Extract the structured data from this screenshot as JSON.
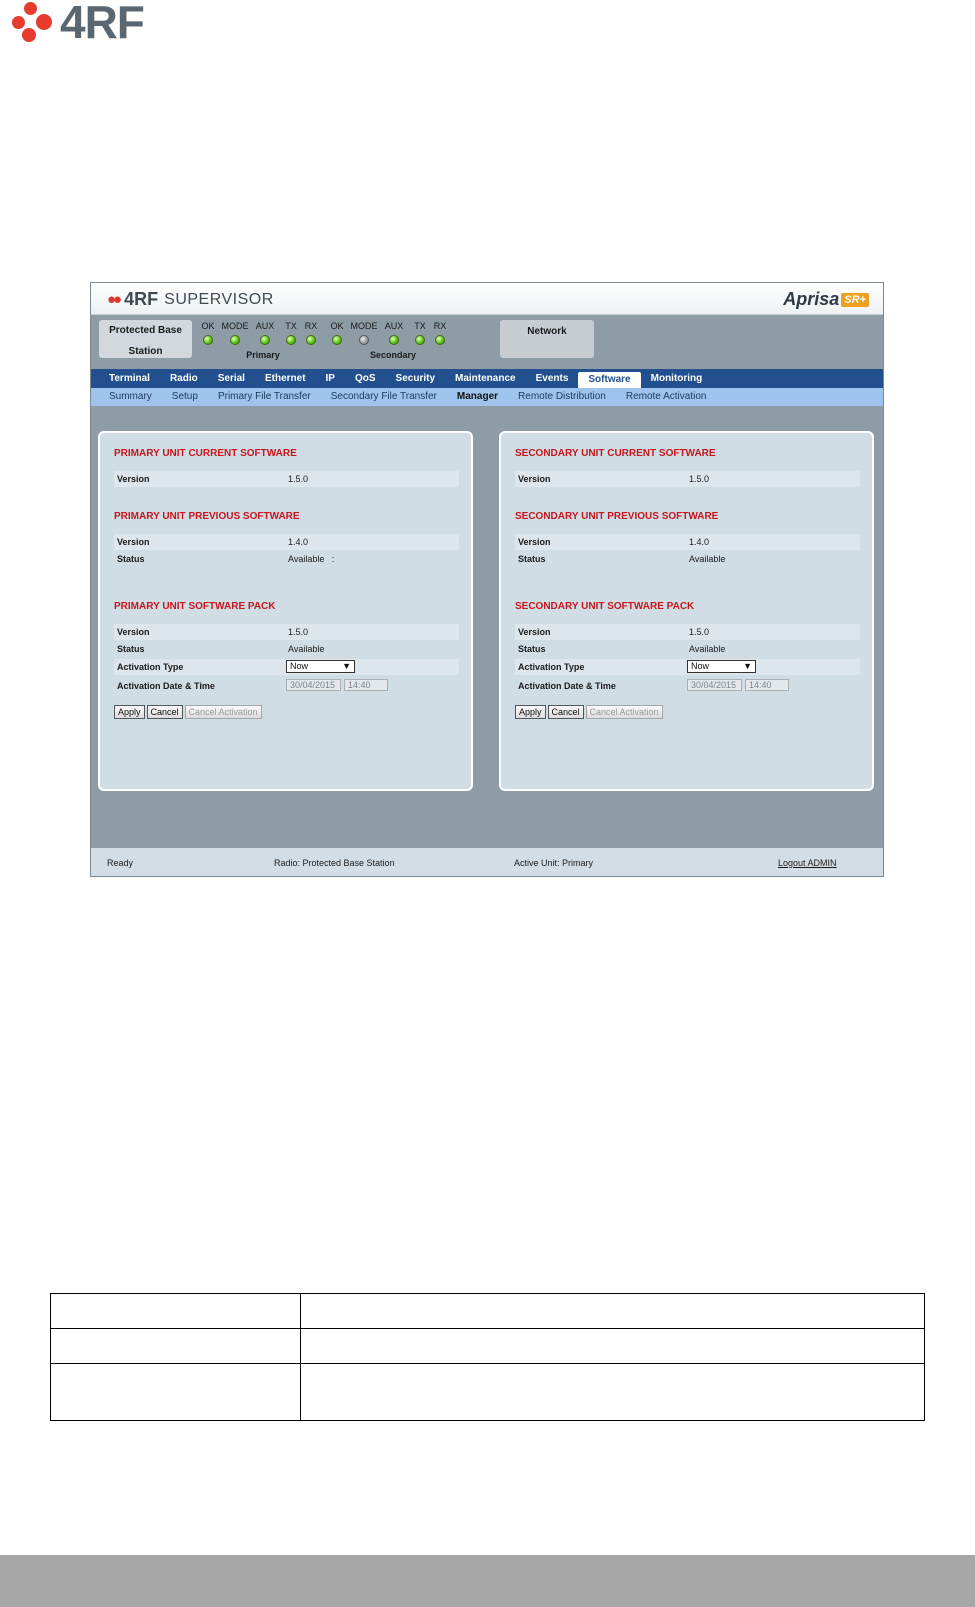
{
  "page_logo": {
    "text": "4RF",
    "icon": "4rf-dots-logo",
    "color": "#e63c2e"
  },
  "app": {
    "brand": {
      "mark": "4RF",
      "name": "SUPERVISOR"
    },
    "product": {
      "name": "Aprisa",
      "badge": "SR+"
    },
    "station": {
      "line1": "Protected Base",
      "line2": "Station"
    },
    "network_label": "Network",
    "primary": {
      "caption": "Primary",
      "leds": [
        {
          "label": "OK",
          "state": "green"
        },
        {
          "label": "MODE",
          "state": "green"
        },
        {
          "label": "AUX",
          "state": "green"
        },
        {
          "label": "TX",
          "state": "green"
        },
        {
          "label": "RX",
          "state": "green"
        }
      ]
    },
    "secondary": {
      "caption": "Secondary",
      "leds": [
        {
          "label": "OK",
          "state": "green"
        },
        {
          "label": "MODE",
          "state": "grey"
        },
        {
          "label": "AUX",
          "state": "green"
        },
        {
          "label": "TX",
          "state": "green"
        },
        {
          "label": "RX",
          "state": "green"
        }
      ]
    },
    "main_nav": [
      "Terminal",
      "Radio",
      "Serial",
      "Ethernet",
      "IP",
      "QoS",
      "Security",
      "Maintenance",
      "Events",
      "Software",
      "Monitoring"
    ],
    "main_nav_active": "Software",
    "sub_nav": [
      "Summary",
      "Setup",
      "Primary File Transfer",
      "Secondary File Transfer",
      "Manager",
      "Remote Distribution",
      "Remote Activation"
    ],
    "sub_nav_active": "Manager",
    "primary_panel": {
      "current_title": "PRIMARY UNIT CURRENT SOFTWARE",
      "current_version_label": "Version",
      "current_version": "1.5.0",
      "previous_title": "PRIMARY UNIT PREVIOUS SOFTWARE",
      "previous_version_label": "Version",
      "previous_version": "1.4.0",
      "previous_status_label": "Status",
      "previous_status": "Available   :",
      "pack_title": "PRIMARY UNIT SOFTWARE PACK",
      "pack_version_label": "Version",
      "pack_version": "1.5.0",
      "pack_status_label": "Status",
      "pack_status": "Available",
      "activation_type_label": "Activation Type",
      "activation_type": "Now",
      "activation_dt_label": "Activation Date & Time",
      "activation_date": "30/04/2015",
      "activation_time": "14:40",
      "apply": "Apply",
      "cancel": "Cancel",
      "cancel_activation": "Cancel Activation"
    },
    "secondary_panel": {
      "current_title": "SECONDARY UNIT CURRENT SOFTWARE",
      "current_version_label": "Version",
      "current_version": "1.5.0",
      "previous_title": "SECONDARY UNIT PREVIOUS SOFTWARE",
      "previous_version_label": "Version",
      "previous_version": "1.4.0",
      "previous_status_label": "Status",
      "previous_status": "Available",
      "pack_title": "SECONDARY UNIT SOFTWARE PACK",
      "pack_version_label": "Version",
      "pack_version": "1.5.0",
      "pack_status_label": "Status",
      "pack_status": "Available",
      "activation_type_label": "Activation Type",
      "activation_type": "Now",
      "activation_dt_label": "Activation Date & Time",
      "activation_date": "30/04/2015",
      "activation_time": "14:40",
      "apply": "Apply",
      "cancel": "Cancel",
      "cancel_activation": "Cancel Activation"
    },
    "statusbar": {
      "state": "Ready",
      "radio": "Radio: Protected Base Station",
      "active_unit": "Active Unit: Primary",
      "logout": "Logout ADMIN"
    }
  }
}
